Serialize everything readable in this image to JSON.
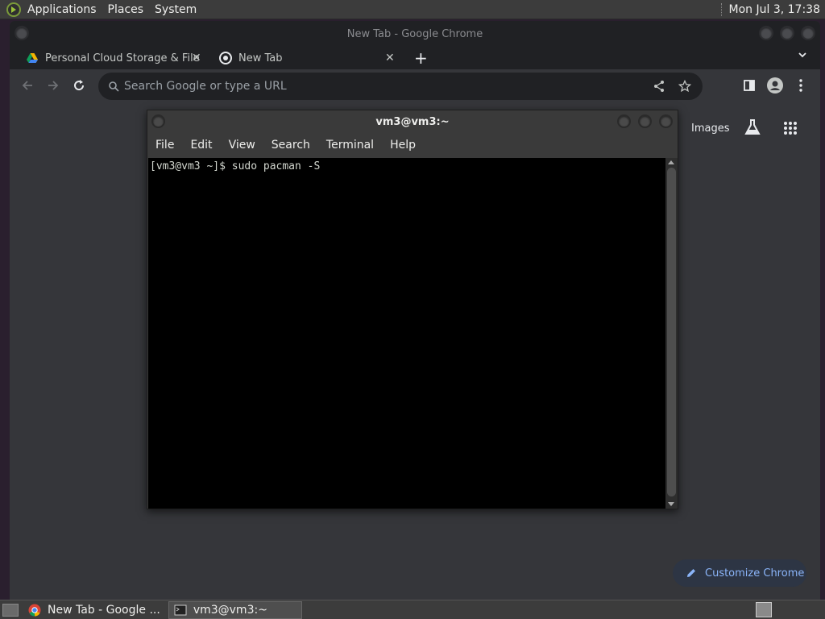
{
  "top_panel": {
    "menus": [
      "Applications",
      "Places",
      "System"
    ],
    "clock": "Mon Jul  3, 17:38"
  },
  "chrome": {
    "window_title": "New Tab - Google Chrome",
    "tabs": [
      {
        "label": "Personal Cloud Storage & File",
        "favicon": "google-drive-icon"
      },
      {
        "label": "New Tab",
        "favicon": "chrome-icon"
      }
    ],
    "omnibox_placeholder": "Search Google or type a URL",
    "newtab": {
      "images_link": "Images",
      "customize_label": "Customize Chrome"
    }
  },
  "terminal": {
    "title": "vm3@vm3:~",
    "menus": [
      "File",
      "Edit",
      "View",
      "Search",
      "Terminal",
      "Help"
    ],
    "lines": [
      "[vm3@vm3 ~]$ sudo pacman -S"
    ]
  },
  "taskbar": {
    "tasks": [
      {
        "label": "New Tab - Google ...",
        "icon": "chrome-icon"
      },
      {
        "label": "vm3@vm3:~",
        "icon": "terminal-icon"
      }
    ]
  },
  "colors": {
    "panel": "#3c3c3c",
    "chrome_frame": "#202124",
    "chrome_toolbar": "#35363a",
    "accent_link": "#8ab4f8",
    "terminal_bg": "#000000"
  }
}
